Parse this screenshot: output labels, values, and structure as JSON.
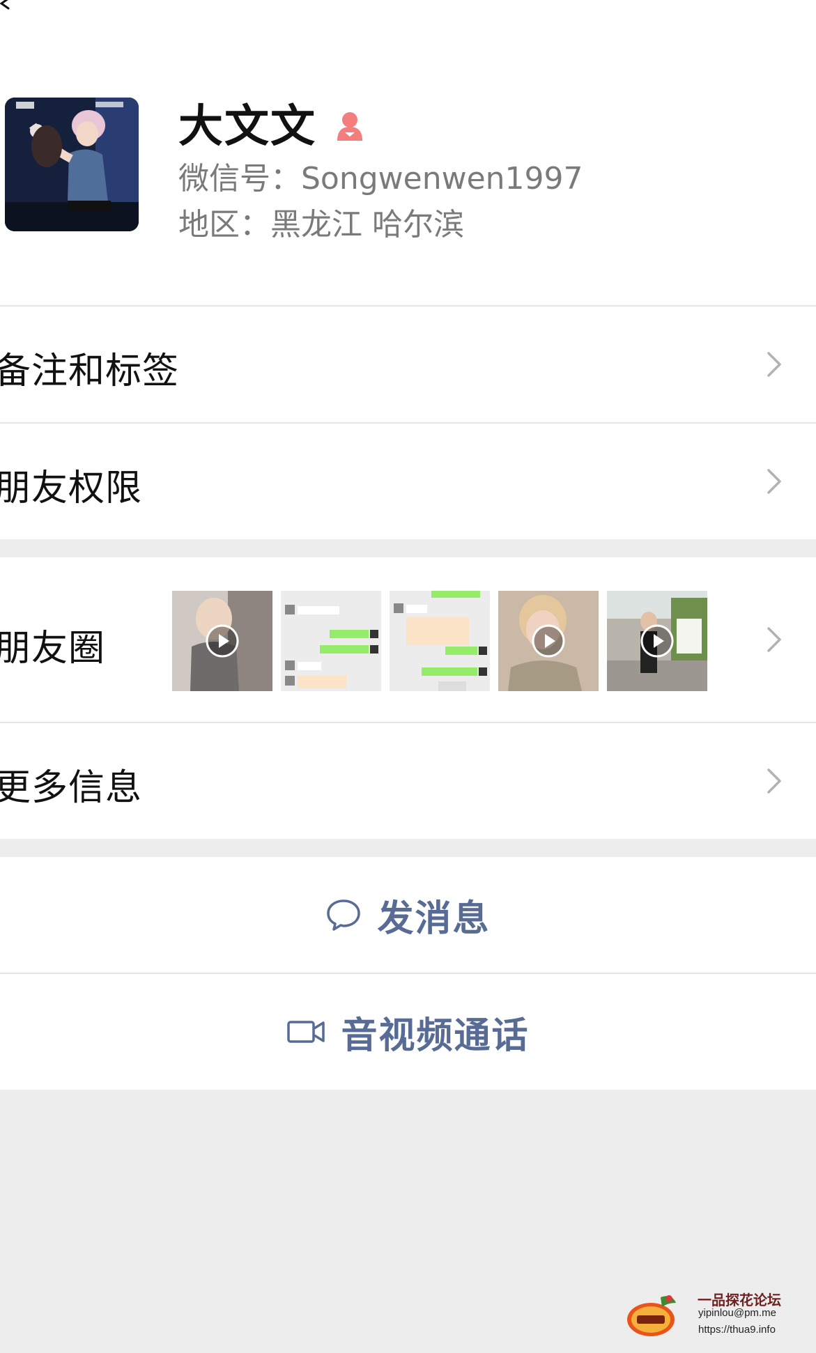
{
  "header": {
    "back_icon": "chevron-left-icon"
  },
  "profile": {
    "name": "大文文",
    "gender_icon": "female-icon",
    "wechat_id": "微信号：Songwenwen1997",
    "region": "地区：黑龙江 哈尔滨"
  },
  "menu": {
    "remarks_tags": "备注和标签",
    "friend_permissions": "朋友权限",
    "moments": "朋友圈",
    "more_info": "更多信息"
  },
  "moments_thumbs": [
    {
      "kind": "video"
    },
    {
      "kind": "chat-screenshot"
    },
    {
      "kind": "chat-screenshot"
    },
    {
      "kind": "video"
    },
    {
      "kind": "video"
    }
  ],
  "actions": {
    "send_message": "发消息",
    "av_call": "音视频通话"
  },
  "watermark": {
    "title": "一品探花论坛",
    "email": "yipinlou@pm.me",
    "url": "https://thua9.info"
  },
  "colors": {
    "accent": "#576b95",
    "female": "#f37e7d",
    "background": "#ededed"
  }
}
